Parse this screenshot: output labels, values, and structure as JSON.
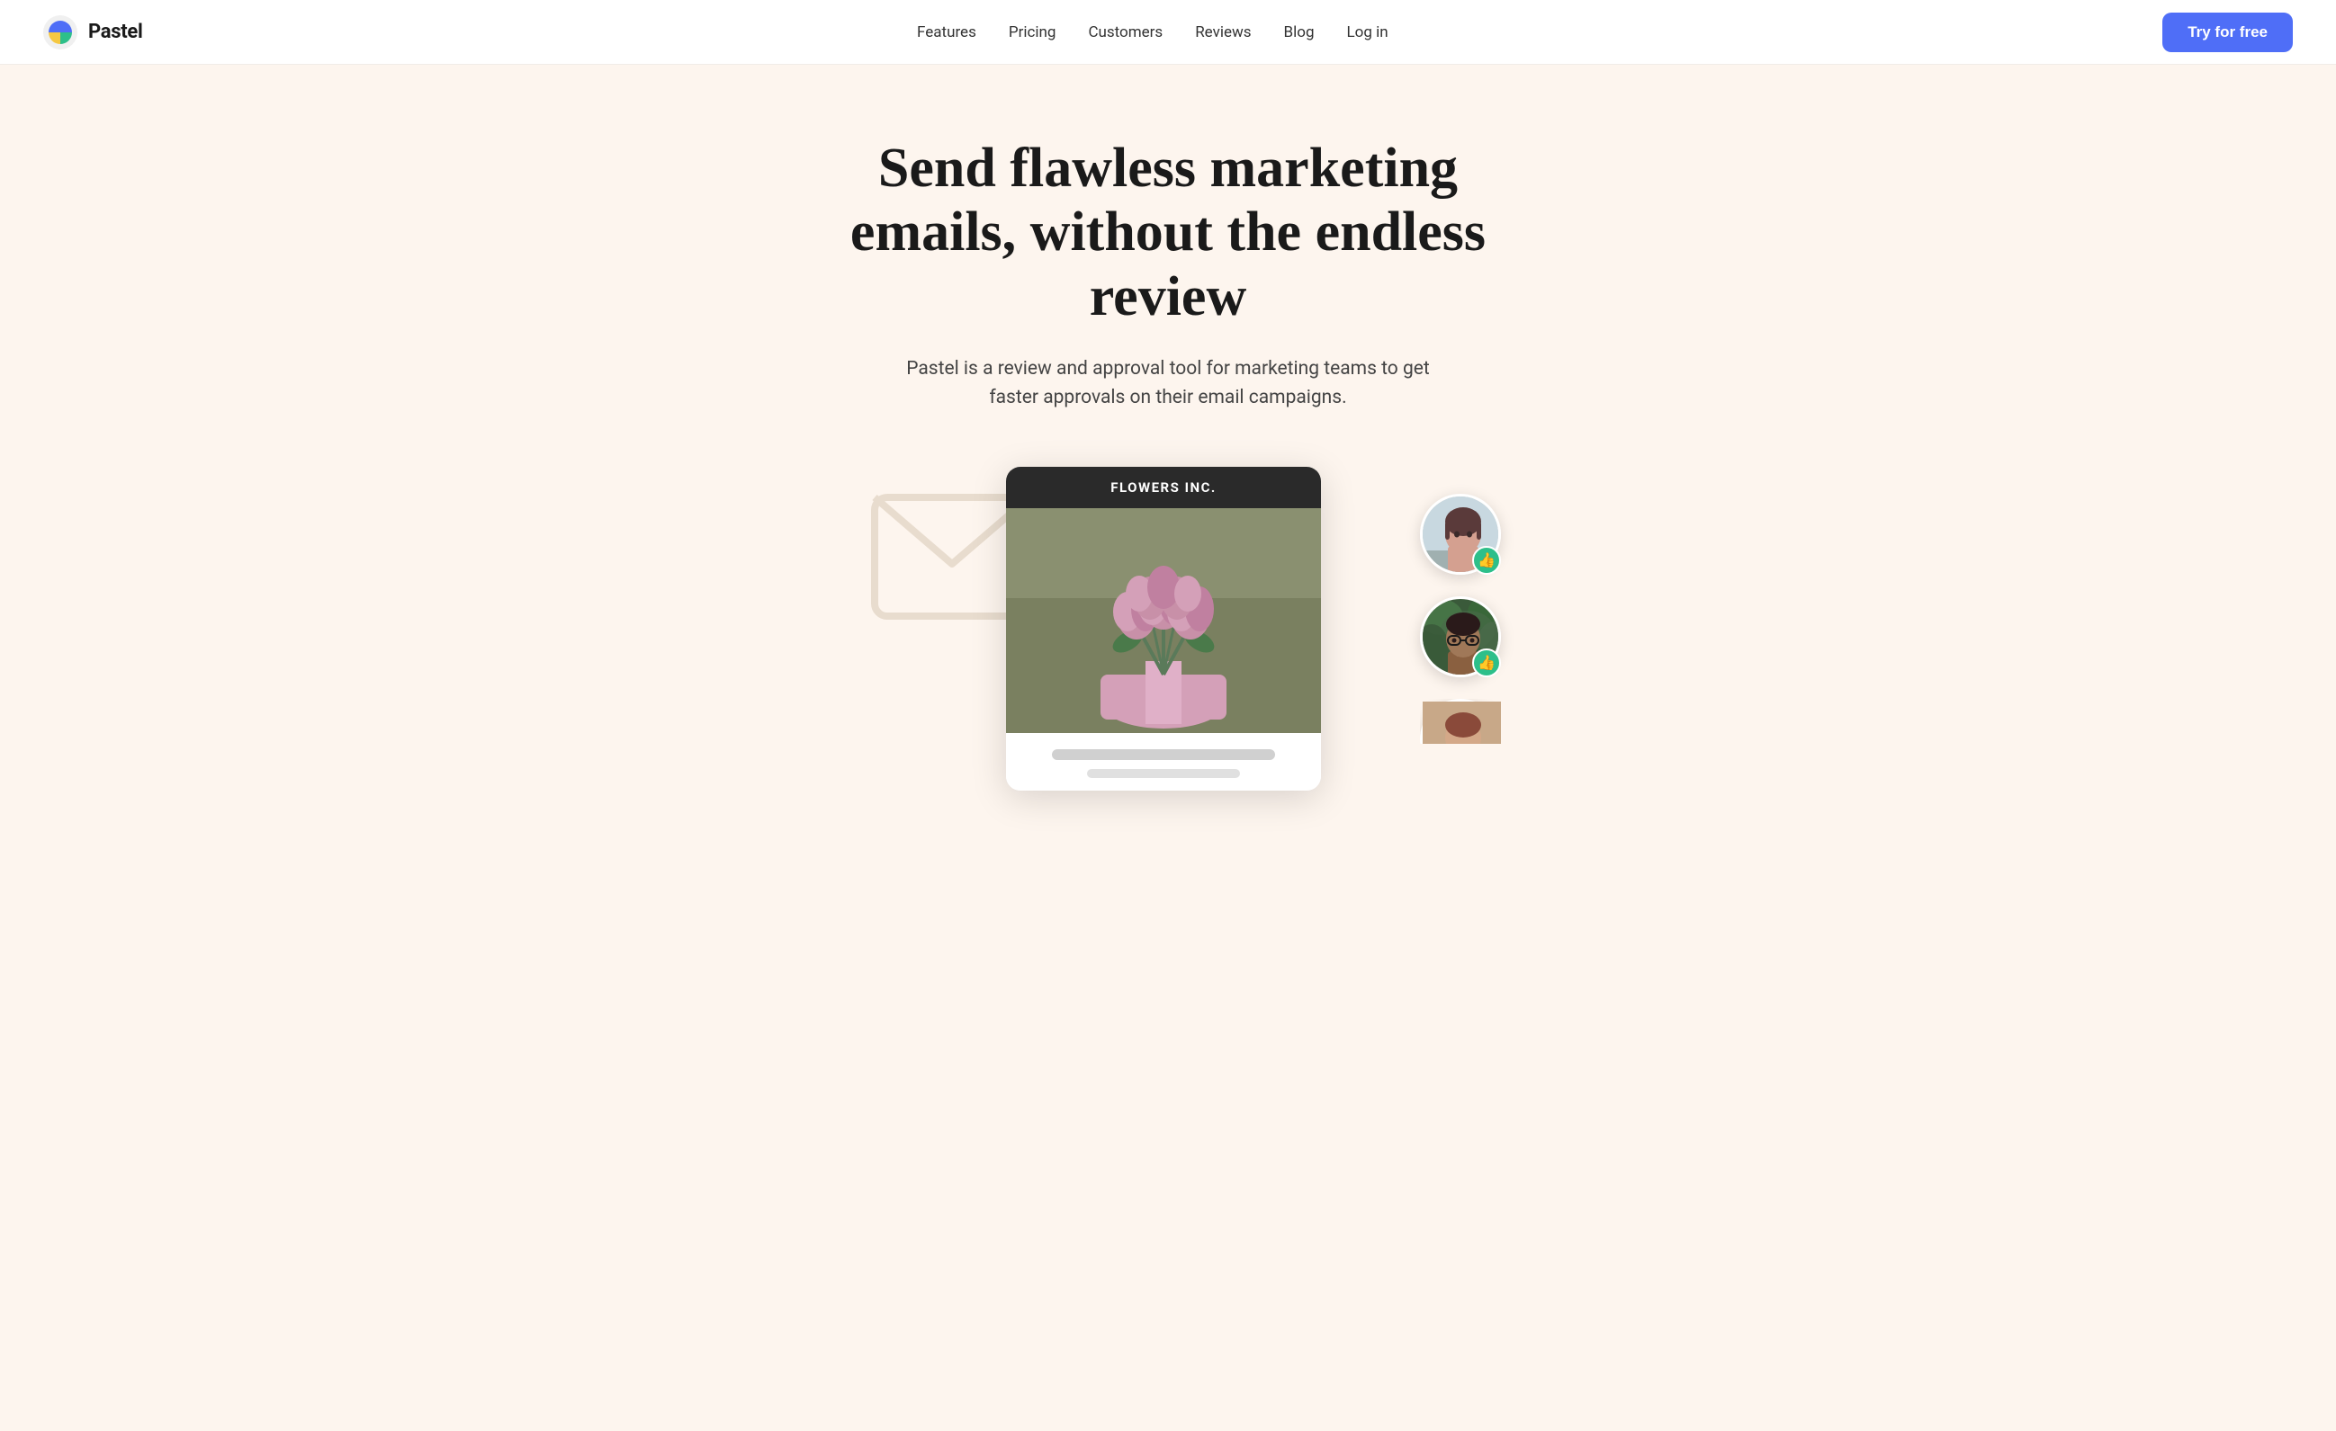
{
  "navbar": {
    "logo_text": "Pastel",
    "nav_links": [
      {
        "label": "Features",
        "id": "features"
      },
      {
        "label": "Pricing",
        "id": "pricing"
      },
      {
        "label": "Customers",
        "id": "customers"
      },
      {
        "label": "Reviews",
        "id": "reviews"
      },
      {
        "label": "Blog",
        "id": "blog"
      },
      {
        "label": "Log in",
        "id": "login"
      }
    ],
    "cta_button": "Try for free"
  },
  "hero": {
    "title": "Send flawless marketing emails, without the endless review",
    "subtitle": "Pastel is a review and approval tool for marketing teams to get faster approvals on their email campaigns.",
    "email_card": {
      "brand": "FLOWERS INC."
    }
  },
  "colors": {
    "background": "#fdf5ee",
    "cta_bg": "#4f6ef7",
    "envelope_outline": "#e0d0c0",
    "thumbs_green": "#2dbf8a"
  }
}
